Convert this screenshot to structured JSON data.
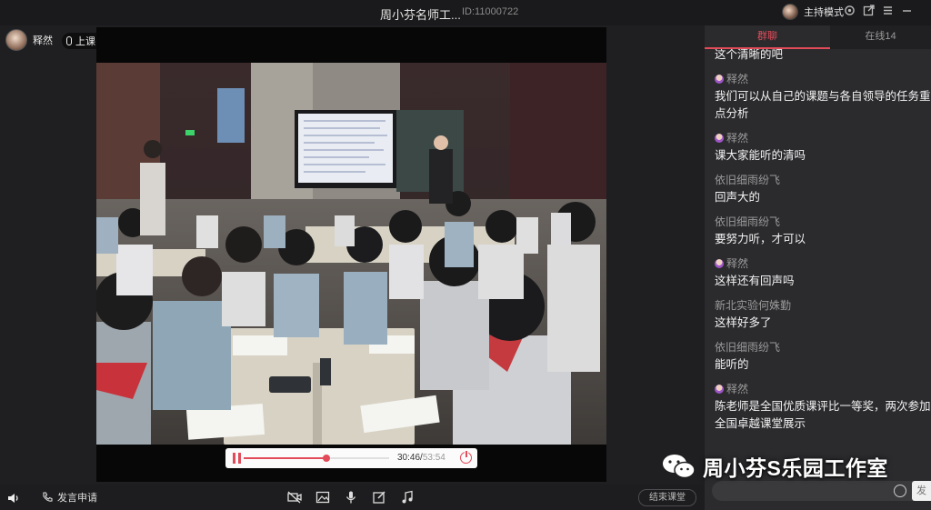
{
  "window": {
    "title": "周小芬名师工...",
    "room_id": "ID:11000722",
    "host_label": "主持模式"
  },
  "stage": {
    "user_name": "释然",
    "mic_status": "上课中"
  },
  "player": {
    "current_time": "30:46",
    "total_time": "53:54",
    "progress_fraction": 0.571
  },
  "bottom_bar": {
    "apply_label": "发言申请",
    "end_class_label": "结束课堂"
  },
  "chat": {
    "tabs": [
      "群聊",
      "在线14"
    ],
    "messages": [
      {
        "sender": "",
        "has_badge": false,
        "text": "这个清晰的吧"
      },
      {
        "sender": "释然",
        "has_badge": true,
        "text": "我们可以从自己的课题与各自领导的任务重点分析"
      },
      {
        "sender": "释然",
        "has_badge": true,
        "text": "课大家能听的清吗"
      },
      {
        "sender": "依旧细雨纷飞",
        "has_badge": false,
        "text": "回声大的"
      },
      {
        "sender": "依旧细雨纷飞",
        "has_badge": false,
        "text": "要努力听，才可以"
      },
      {
        "sender": "释然",
        "has_badge": true,
        "text": "这样还有回声吗"
      },
      {
        "sender": "新北实验何姝勤",
        "has_badge": false,
        "text": "这样好多了"
      },
      {
        "sender": "依旧细雨纷飞",
        "has_badge": false,
        "text": "能听的"
      },
      {
        "sender": "释然",
        "has_badge": true,
        "text": "陈老师是全国优质课评比一等奖，两次参加全国卓越课堂展示"
      }
    ],
    "send_label": "发"
  },
  "watermark": {
    "text": "周小芬S乐园工作室"
  },
  "icons": {
    "tb": [
      "settings-icon",
      "popout-icon",
      "menu-icon",
      "minimize-icon"
    ],
    "tools": [
      "camera-off-icon",
      "image-icon",
      "microphone-icon",
      "edit-icon",
      "music-icon"
    ]
  },
  "colors": {
    "accent": "#e24b59",
    "background": "#1f1f21",
    "panel": "#2b2b2e"
  }
}
